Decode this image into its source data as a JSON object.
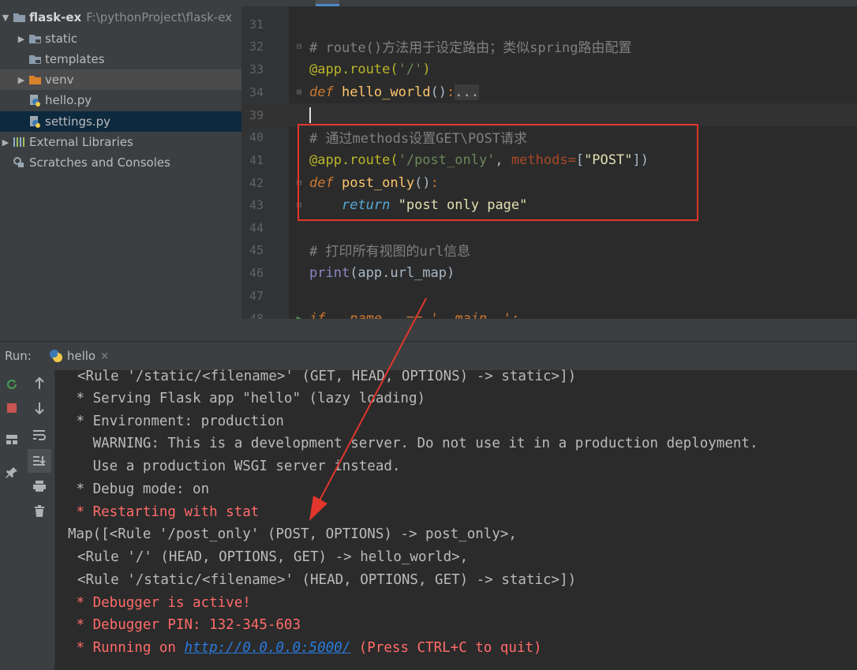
{
  "project": {
    "root_name": "flask-ex",
    "root_path": "F:\\pythonProject\\flask-ex",
    "items": [
      {
        "label": "static"
      },
      {
        "label": "templates"
      },
      {
        "label": "venv"
      },
      {
        "label": "hello.py"
      },
      {
        "label": "settings.py"
      }
    ],
    "external_libraries": "External Libraries",
    "scratches": "Scratches and Consoles"
  },
  "editor": {
    "line_numbers": [
      "31",
      "32",
      "33",
      "34",
      "39",
      "40",
      "41",
      "42",
      "43",
      "44",
      "45",
      "46",
      "47",
      "48"
    ],
    "lines": {
      "l32_comment": "# route()方法用于设定路由；类似spring路由配置",
      "l33_deco": "@app.route(",
      "l33_str": "'/'",
      "l33_close": ")",
      "l34_def": "def",
      "l34_fn": "hello_world",
      "l34_paren": "()",
      "l34_colon": ":",
      "l34_fold": "...",
      "l40_comment": "# 通过methods设置GET\\POST请求",
      "l41_deco": "@app.route(",
      "l41_str": "'/post_only'",
      "l41_comma": ", ",
      "l41_param": "methods",
      "l41_eq": "=",
      "l41_open": "[",
      "l41_val": "\"POST\"",
      "l41_close": "])",
      "l42_def": "def",
      "l42_fn": "post_only",
      "l42_paren": "()",
      "l42_colon": ":",
      "l43_ret": "return",
      "l43_str": "\"post only page\"",
      "l45_comment": "# 打印所有视图的url信息",
      "l46_print": "print",
      "l46_rest": "(app.url_map)",
      "l48_partial": "if __name__ == '__main__':"
    }
  },
  "run": {
    "label": "Run:",
    "tab": "hello",
    "close": "×"
  },
  "console": [
    {
      "text": "<Rule '/static/<filename>' (GET, HEAD, OPTIONS) -> static>])",
      "style": "normal",
      "indent": 12
    },
    {
      "text": " * Serving Flask app \"hello\" (lazy loading)",
      "style": "normal",
      "indent": 0
    },
    {
      "text": " * Environment: production",
      "style": "normal",
      "indent": 0
    },
    {
      "text": "   WARNING: This is a development server. Do not use it in a production deployment.",
      "style": "normal",
      "indent": 0
    },
    {
      "text": "   Use a production WSGI server instead.",
      "style": "normal",
      "indent": 0
    },
    {
      "text": " * Debug mode: on",
      "style": "normal",
      "indent": 0
    },
    {
      "text": " * Restarting with stat",
      "style": "red",
      "indent": 0
    },
    {
      "text": "Map([<Rule '/post_only' (POST, OPTIONS) -> post_only>,",
      "style": "normal",
      "indent": -12
    },
    {
      "text": "<Rule '/' (HEAD, OPTIONS, GET) -> hello_world>,",
      "style": "normal",
      "indent": 12
    },
    {
      "text": "<Rule '/static/<filename>' (HEAD, OPTIONS, GET) -> static>])",
      "style": "normal",
      "indent": 12
    },
    {
      "text": " * Debugger is active!",
      "style": "red",
      "indent": 0
    },
    {
      "text": " * Debugger PIN: 132-345-603",
      "style": "red",
      "indent": 0
    }
  ],
  "console_last": {
    "prefix": " * Running on ",
    "link": "http://0.0.0.0:5000/",
    "suffix": " (Press CTRL+C to quit)"
  },
  "colors": {
    "annotation_red": "#e0362c",
    "console_red": "#ff6b68",
    "link_blue": "#287bde",
    "selection": "#0d293e"
  }
}
